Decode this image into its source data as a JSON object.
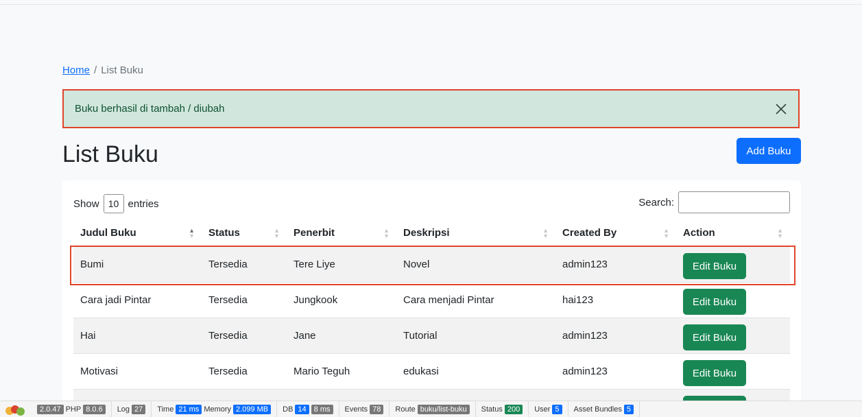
{
  "breadcrumb": {
    "home": "Home",
    "separator": "/",
    "current": "List Buku"
  },
  "alert": {
    "message": "Buku berhasil di tambah / diubah",
    "close": "✕"
  },
  "page": {
    "title": "List Buku",
    "add_button": "Add Buku"
  },
  "table_controls": {
    "show_label": "Show",
    "length_value": "10",
    "entries_label": "entries",
    "search_label": "Search:",
    "search_value": ""
  },
  "columns": [
    "Judul Buku",
    "Status",
    "Penerbit",
    "Deskripsi",
    "Created By",
    "Action"
  ],
  "rows": [
    {
      "judul": "Bumi",
      "status": "Tersedia",
      "penerbit": "Tere Liye",
      "deskripsi": "Novel",
      "created_by": "admin123",
      "action": "Edit Buku"
    },
    {
      "judul": "Cara jadi Pintar",
      "status": "Tersedia",
      "penerbit": "Jungkook",
      "deskripsi": "Cara menjadi Pintar",
      "created_by": "hai123",
      "action": "Edit Buku"
    },
    {
      "judul": "Hai",
      "status": "Tersedia",
      "penerbit": "Jane",
      "deskripsi": "Tutorial",
      "created_by": "admin123",
      "action": "Edit Buku"
    },
    {
      "judul": "Motivasi",
      "status": "Tersedia",
      "penerbit": "Mario Teguh",
      "deskripsi": "edukasi",
      "created_by": "admin123",
      "action": "Edit Buku"
    },
    {
      "judul": "",
      "status": "",
      "penerbit": "",
      "deskripsi": "",
      "created_by": "",
      "action": "Edit Buku"
    }
  ],
  "debug_bar": {
    "version": "2.0.47",
    "php_label": "PHP",
    "php_value": "8.0.6",
    "log_label": "Log",
    "log_value": "27",
    "time_label": "Time",
    "time_value": "21 ms",
    "memory_label": "Memory",
    "memory_value": "2.099 MB",
    "db_label": "DB",
    "db_count": "14",
    "db_time": "8 ms",
    "events_label": "Events",
    "events_value": "78",
    "route_label": "Route",
    "route_value": "buku/list-buku",
    "status_label": "Status",
    "status_value": "200",
    "user_label": "User",
    "user_value": "5",
    "assets_label": "Asset Bundles",
    "assets_value": "5"
  },
  "colors": {
    "primary": "#0d6efd",
    "success": "#198754",
    "alert_bg": "#d1e7dd",
    "highlight": "#e0442a"
  }
}
